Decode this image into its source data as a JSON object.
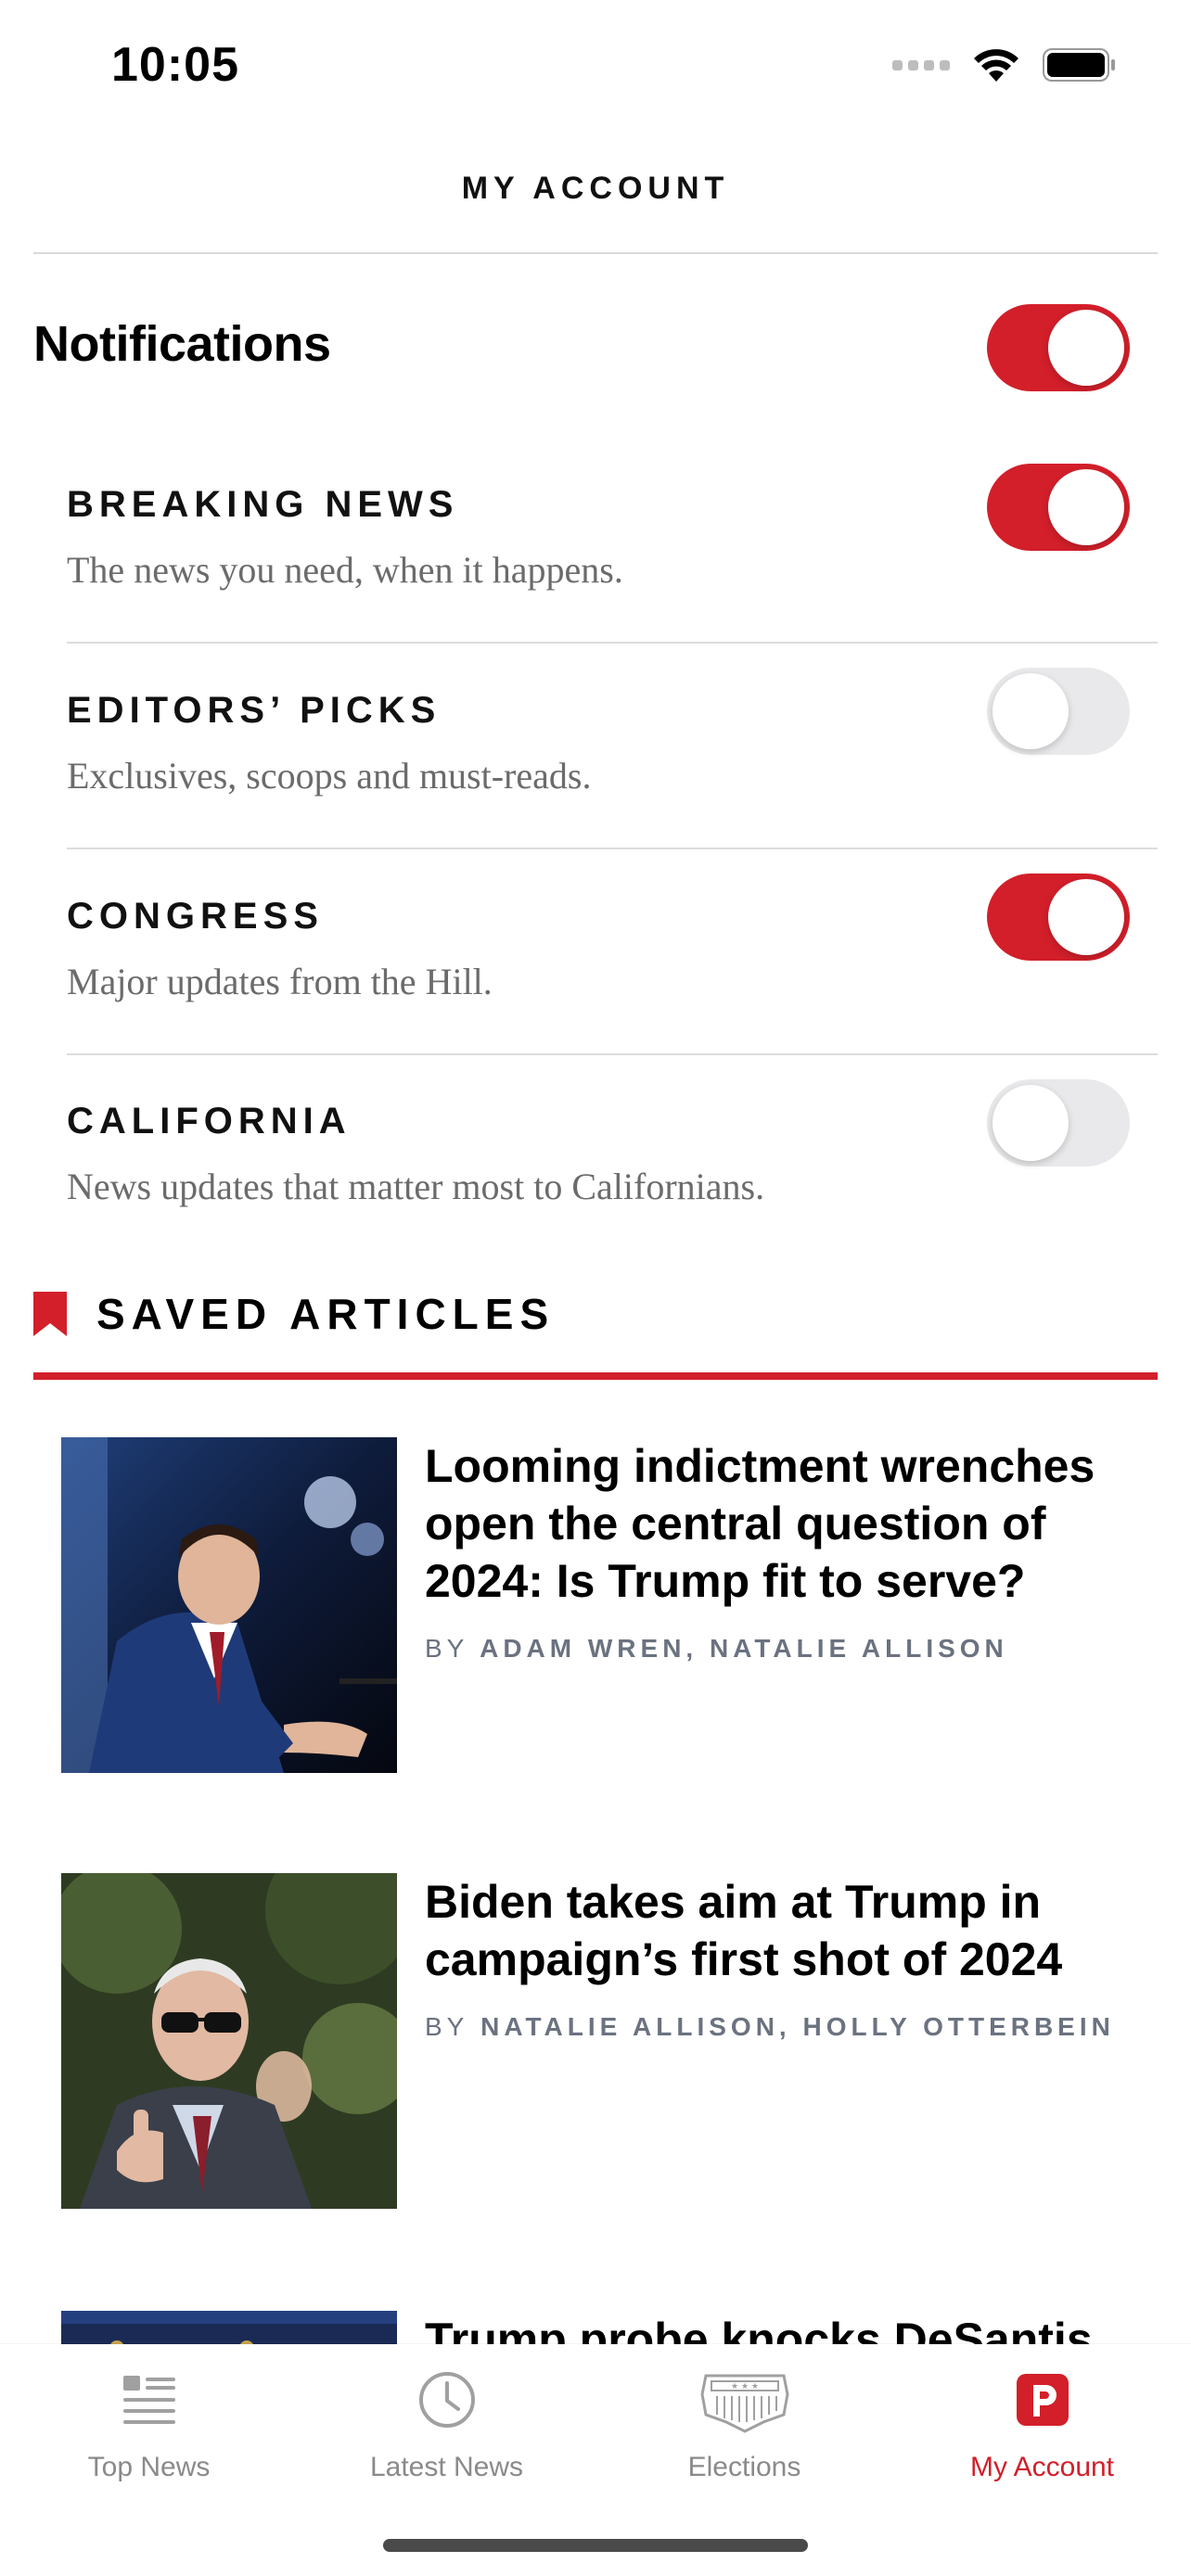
{
  "status_bar": {
    "time": "10:05"
  },
  "header": {
    "title": "MY ACCOUNT"
  },
  "notifications": {
    "heading": "Notifications",
    "master_enabled": true,
    "items": [
      {
        "title": "BREAKING NEWS",
        "description": "The news you need, when it happens.",
        "enabled": true
      },
      {
        "title": "EDITORS’ PICKS",
        "description": "Exclusives, scoops and must-reads.",
        "enabled": false
      },
      {
        "title": "CONGRESS",
        "description": "Major updates from the Hill.",
        "enabled": true
      },
      {
        "title": "CALIFORNIA",
        "description": "News updates that matter most to Californians.",
        "enabled": false
      }
    ]
  },
  "saved_articles": {
    "title": "SAVED ARTICLES",
    "articles": [
      {
        "headline": "Looming indictment wrenches open the central question of 2024: Is Trump fit to serve?",
        "by": "BY",
        "authors": "ADAM WREN, NATALIE ALLISON"
      },
      {
        "headline": "Biden takes aim at Trump in campaign’s first shot of 2024",
        "by": "BY",
        "authors": "NATALIE ALLISON, HOLLY OTTERBEIN"
      },
      {
        "headline": "Trump probe knocks DeSantis",
        "by": "",
        "authors": ""
      }
    ]
  },
  "tab_bar": {
    "tabs": [
      {
        "label": "Top News",
        "icon": "top-news-icon",
        "active": false
      },
      {
        "label": "Latest News",
        "icon": "clock-icon",
        "active": false
      },
      {
        "label": "Elections",
        "icon": "capitol-icon",
        "active": false
      },
      {
        "label": "My Account",
        "icon": "politico-p-icon",
        "active": true
      }
    ]
  },
  "colors": {
    "accent": "#d21f2a",
    "toggle_off": "#e9e9eb",
    "muted_text": "#6b6b6b",
    "byline": "#6b7280"
  }
}
